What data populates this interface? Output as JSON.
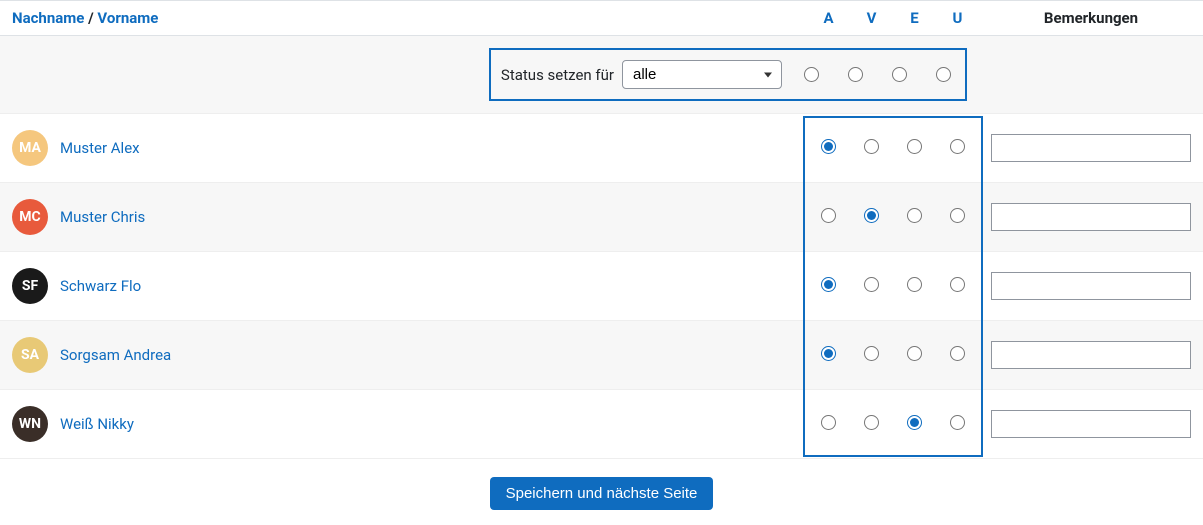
{
  "header": {
    "nachname": "Nachname",
    "vorname": "Vorname",
    "sep": " / ",
    "cols": [
      "A",
      "V",
      "E",
      "U"
    ],
    "remarks": "Bemerkungen"
  },
  "setall": {
    "label": "Status setzen für",
    "selected": "alle"
  },
  "students": [
    {
      "name": "Muster Alex",
      "avatar_bg": "#f5c77e",
      "avatar_text": "MA",
      "selected": 0,
      "remarks": ""
    },
    {
      "name": "Muster Chris",
      "avatar_bg": "#e85a3c",
      "avatar_text": "MC",
      "selected": 1,
      "remarks": ""
    },
    {
      "name": "Schwarz Flo",
      "avatar_bg": "#1a1a1a",
      "avatar_text": "SF",
      "selected": 0,
      "remarks": ""
    },
    {
      "name": "Sorgsam Andrea",
      "avatar_bg": "#e8c976",
      "avatar_text": "SA",
      "selected": 0,
      "remarks": ""
    },
    {
      "name": "Weiß Nikky",
      "avatar_bg": "#3a2e28",
      "avatar_text": "WN",
      "selected": 2,
      "remarks": ""
    }
  ],
  "footer": {
    "save": "Speichern und nächste Seite"
  }
}
